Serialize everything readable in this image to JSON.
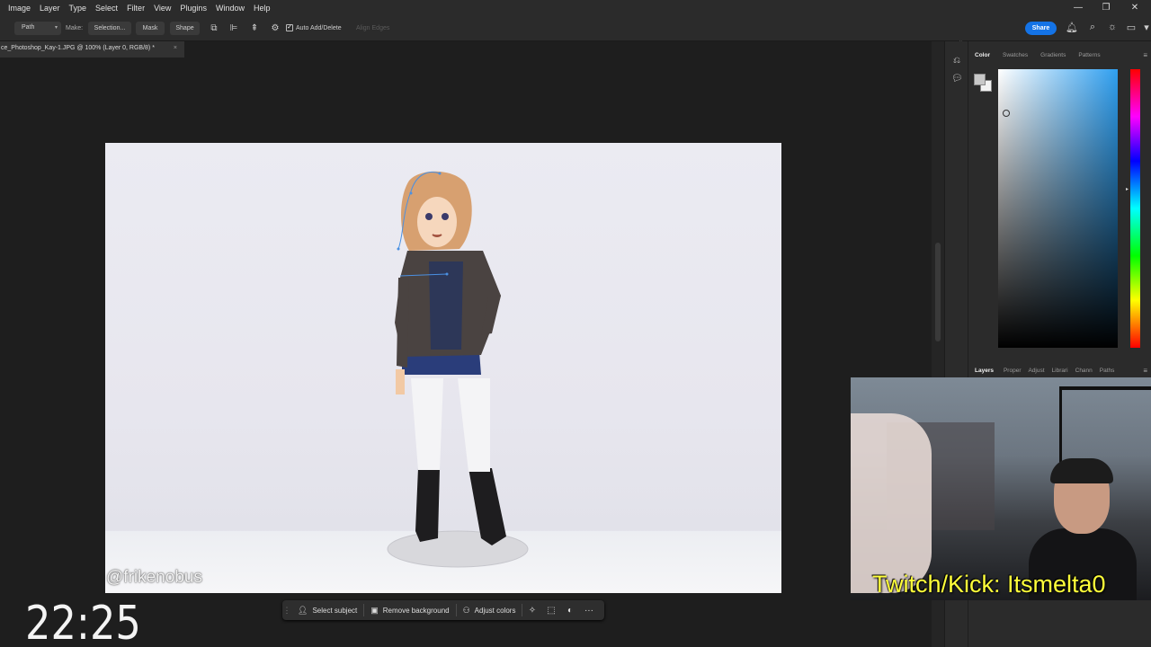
{
  "menubar": {
    "items": [
      "Image",
      "Layer",
      "Type",
      "Select",
      "Filter",
      "View",
      "Plugins",
      "Window",
      "Help"
    ]
  },
  "window_controls": {
    "minimize": "—",
    "restore": "❐",
    "close": "✕"
  },
  "options_bar": {
    "mode_select": "Path",
    "make_label": "Make:",
    "selection_btn": "Selection...",
    "mask_btn": "Mask",
    "shape_btn": "Shape",
    "auto_add_delete": "Auto Add/Delete",
    "align_edges": "Align Edges",
    "share": "Share"
  },
  "document": {
    "tab_title": "ce_Photoshop_Kay-1.JPG @ 100% (Layer 0, RGB/8) *",
    "tab_close": "×",
    "watermark": "@frikenobus"
  },
  "taskbar": {
    "select_subject": "Select subject",
    "remove_background": "Remove background",
    "adjust_colors": "Adjust colors",
    "more": "···"
  },
  "timer": "22:25",
  "panels": {
    "color_tabs": [
      "Color",
      "Swatches",
      "Gradients",
      "Patterns"
    ],
    "layers_tabs": [
      "Layers",
      "Proper",
      "Adjust",
      "Librari",
      "Chann",
      "Paths"
    ],
    "colors": {
      "foreground": "#c8c8c8",
      "background": "#f2f2f2",
      "picker_hue": "#2f9ff0"
    }
  },
  "webcam": {
    "overlay_text": "Twitch/Kick: Itsmelta0"
  },
  "colors": {
    "accent": "#1473e6",
    "path_outline": "#4a90e2"
  }
}
